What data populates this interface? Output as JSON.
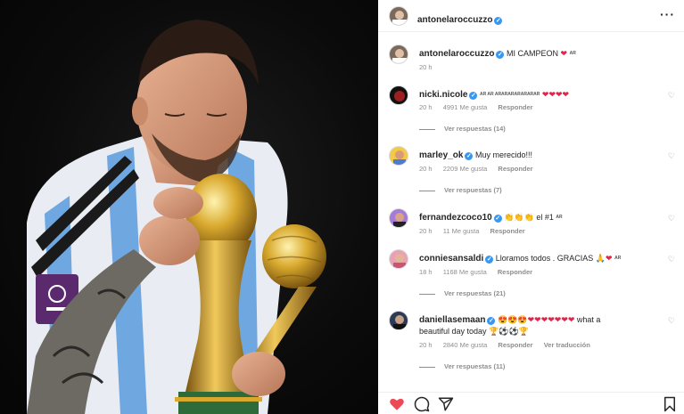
{
  "post": {
    "author": "antonelaroccuzzo",
    "more_icon": "more-horizontal-icon",
    "caption": {
      "username": "antonelaroccuzzo",
      "text": "MI CAMPEON",
      "suffix": "AR",
      "time": "20 h"
    }
  },
  "comments": [
    {
      "username": "nicki.nicole",
      "text": "AR AR ARARARARARARAR",
      "emoji": "❤❤❤❤",
      "time": "20 h",
      "likes": "4991 Me gusta",
      "reply_label": "Responder",
      "replies": "Ver respuestas (14)"
    },
    {
      "username": "marley_ok",
      "text": "Muy merecido!!!",
      "emoji": "",
      "time": "20 h",
      "likes": "2209 Me gusta",
      "reply_label": "Responder",
      "replies": "Ver respuestas (7)"
    },
    {
      "username": "fernandezcoco10",
      "text": "el #1",
      "emoji": "👏👏👏",
      "suffix": "AR",
      "time": "20 h",
      "likes": "11 Me gusta",
      "reply_label": "Responder",
      "replies": ""
    },
    {
      "username": "conniesansaldi",
      "text": "Lloramos todos . GRACIAS",
      "emoji": "🙏",
      "suffix": "AR",
      "time": "18 h",
      "likes": "1168 Me gusta",
      "reply_label": "Responder",
      "replies": "Ver respuestas (21)"
    },
    {
      "username": "daniellasemaan",
      "emoji_line1": "😍😍😍❤❤❤❤❤❤❤",
      "text_line1": "what a",
      "text_line2": "beautiful day today",
      "emoji_line2": "🏆⚽⚽🏆",
      "time": "20 h",
      "likes": "2840 Me gusta",
      "reply_label": "Responder",
      "translate_label": "Ver traducción",
      "replies": "Ver respuestas (11)"
    }
  ],
  "actions": {
    "like_color": "#ed4956",
    "icons": [
      "heart-filled-icon",
      "comment-icon",
      "share-icon",
      "bookmark-icon"
    ]
  },
  "colors": {
    "verified": "#3897f0",
    "heart": "#e0244a",
    "muted": "#8e8e8e"
  }
}
